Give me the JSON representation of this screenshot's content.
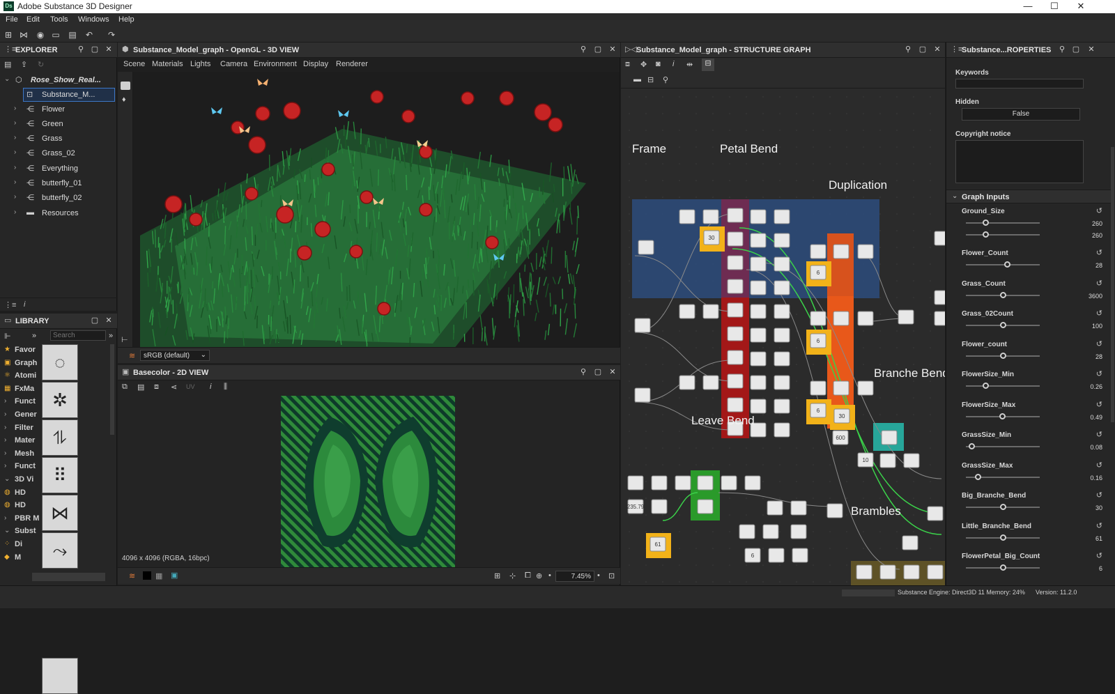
{
  "app": {
    "logo": "Ds",
    "title": "Adobe Substance 3D Designer",
    "window_controls": [
      "—",
      "☐",
      "✕"
    ]
  },
  "menu": [
    "File",
    "Edit",
    "Tools",
    "Windows",
    "Help"
  ],
  "explorer": {
    "title": "EXPLORER",
    "package": "Rose_Show_Real...",
    "selected_graph": "Substance_M...",
    "items": [
      "Flower",
      "Green",
      "Grass",
      "Grass_02",
      "Everything",
      "butterfly_01",
      "butterfly_02",
      "Resources"
    ]
  },
  "library": {
    "title": "LIBRARY",
    "search_placeholder": "Search",
    "categories": [
      {
        "arrow": "",
        "icon": "★",
        "label": "Favor"
      },
      {
        "arrow": "",
        "icon": "▣",
        "label": "Graph"
      },
      {
        "arrow": "",
        "icon": "⚛",
        "label": "Atomi"
      },
      {
        "arrow": "",
        "icon": "▦",
        "label": "FxMa"
      },
      {
        "arrow": "›",
        "icon": "",
        "label": "Funct"
      },
      {
        "arrow": "›",
        "icon": "",
        "label": "Gener"
      },
      {
        "arrow": "›",
        "icon": "",
        "label": "Filter"
      },
      {
        "arrow": "›",
        "icon": "",
        "label": "Mater"
      },
      {
        "arrow": "›",
        "icon": "",
        "label": "Mesh"
      },
      {
        "arrow": "›",
        "icon": "",
        "label": "Funct"
      },
      {
        "arrow": "⌄",
        "icon": "",
        "label": "3D Vi"
      },
      {
        "arrow": "",
        "icon": "◍",
        "label": "HD"
      },
      {
        "arrow": "",
        "icon": "◍",
        "label": "HD"
      },
      {
        "arrow": "›",
        "icon": "",
        "label": "PBR M"
      },
      {
        "arrow": "⌄",
        "icon": "",
        "label": "Subst"
      },
      {
        "arrow": "",
        "icon": "⁘",
        "label": "Di"
      },
      {
        "arrow": "",
        "icon": "◆",
        "label": "M"
      }
    ]
  },
  "view3d": {
    "title": "Substance_Model_graph - OpenGL - 3D VIEW",
    "menus": [
      "Scene",
      "Materials",
      "Lights",
      "Camera",
      "Environment",
      "Display",
      "Renderer"
    ],
    "colorspace": "sRGB (default)"
  },
  "view2d": {
    "title": "Basecolor - 2D VIEW",
    "uv_label": "UV",
    "info": "4096 x 4096 (RGBA, 16bpc)",
    "zoom": "7.45%"
  },
  "graph": {
    "title": "Substance_Model_graph - STRUCTURE GRAPH",
    "frames": [
      "Frame",
      "Petal Bend",
      "Duplication",
      "Branche Bend",
      "Leave Bend",
      "Brambles"
    ],
    "node_values": [
      "30",
      "6",
      "6",
      "6",
      "30",
      "600",
      "10",
      "61",
      "235.79",
      "6"
    ]
  },
  "properties": {
    "title": "Substance...ROPERTIES",
    "keywords_label": "Keywords",
    "hidden_label": "Hidden",
    "hidden_value": "False",
    "copyright_label": "Copyright notice",
    "graph_inputs_label": "Graph Inputs",
    "inputs": [
      {
        "name": "Ground_Size",
        "values": [
          "260",
          "260"
        ],
        "levels": [
          0.26,
          0.26
        ]
      },
      {
        "name": "Flower_Count",
        "values": [
          "28"
        ],
        "levels": [
          0.56
        ]
      },
      {
        "name": "Grass_Count",
        "values": [
          "3600"
        ],
        "levels": [
          0.5
        ]
      },
      {
        "name": "Grass_02Count",
        "values": [
          "100"
        ],
        "levels": [
          0.5
        ]
      },
      {
        "name": "Flower_count",
        "values": [
          "28"
        ],
        "levels": [
          0.5
        ]
      },
      {
        "name": "FlowerSize_Min",
        "values": [
          "0.26"
        ],
        "levels": [
          0.26
        ]
      },
      {
        "name": "FlowerSize_Max",
        "values": [
          "0.49"
        ],
        "levels": [
          0.49
        ]
      },
      {
        "name": "GrassSize_Min",
        "values": [
          "0.08"
        ],
        "levels": [
          0.08
        ]
      },
      {
        "name": "GrassSize_Max",
        "values": [
          "0.16"
        ],
        "levels": [
          0.16
        ]
      },
      {
        "name": "Big_Branche_Bend",
        "values": [
          "30"
        ],
        "levels": [
          0.5
        ]
      },
      {
        "name": "Little_Branche_Bend",
        "values": [
          "61"
        ],
        "levels": [
          0.5
        ]
      },
      {
        "name": "FlowerPetal_Big_Count",
        "values": [
          "6"
        ],
        "levels": [
          0.5
        ]
      }
    ]
  },
  "status": {
    "engine": "Substance Engine: Direct3D 11  Memory: 24%",
    "version": "Version: 11.2.0"
  },
  "colors": {
    "frame_blue": "#2c4a78",
    "petal_purple": "#6e2c52",
    "petal_red": "#a31818",
    "duplication_orange": "#e8581a",
    "node_yellow": "#f2b219",
    "branche_teal": "#27a69a",
    "leave_green": "#2a9a2a",
    "brambles_olive": "#5e5226"
  }
}
